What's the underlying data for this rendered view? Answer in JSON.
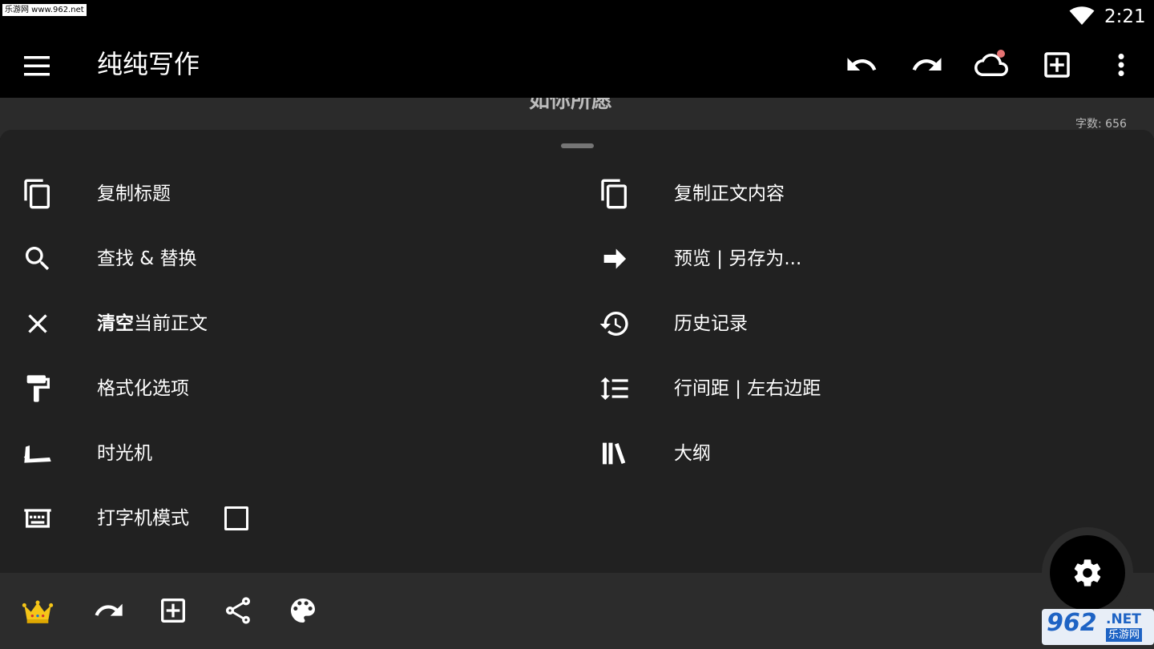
{
  "status_bar": {
    "watermark": "乐游网 www.962.net",
    "time": "2:21"
  },
  "app_bar": {
    "title": "纯纯写作"
  },
  "document": {
    "title_partial": "如你所愿",
    "word_count": "字数: 656"
  },
  "menu": {
    "left": [
      {
        "label": "复制标题",
        "icon": "copy-icon"
      },
      {
        "label": "查找 & 替换",
        "icon": "search-icon"
      },
      {
        "label_bold": "清空",
        "label": "当前正文",
        "icon": "close-icon"
      },
      {
        "label": "格式化选项",
        "icon": "paint-roller-icon"
      },
      {
        "label": "时光机",
        "icon": "time-machine-icon"
      },
      {
        "label": "打字机模式",
        "icon": "typewriter-icon"
      }
    ],
    "right": [
      {
        "label": "复制正文内容",
        "icon": "copy-icon"
      },
      {
        "label": "预览 | 另存为...",
        "icon": "arrow-right-icon"
      },
      {
        "label": "历史记录",
        "icon": "history-icon"
      },
      {
        "label": "行间距 | 左右边距",
        "icon": "line-spacing-icon"
      },
      {
        "label": "大纲",
        "icon": "library-icon"
      }
    ]
  },
  "bottom_bar": {
    "icons": [
      "crown-icon",
      "redo-icon",
      "add-box-icon",
      "share-icon",
      "palette-icon"
    ]
  },
  "fab": {
    "icon": "gear-icon"
  },
  "watermark_br": {
    "num": "962",
    "net": ".NET",
    "cn": "乐游网"
  },
  "colors": {
    "background": "#212121",
    "app_bar": "#000000",
    "bottom_bar": "#2c2c2c",
    "crown": "#f5c518",
    "cloud_dot": "#e57373"
  }
}
